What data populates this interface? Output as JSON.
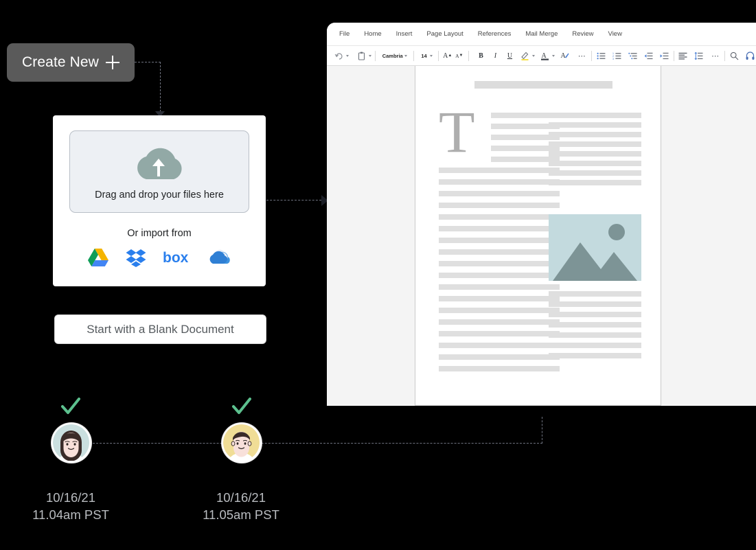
{
  "create_new": {
    "label": "Create New",
    "icon": "plus-icon"
  },
  "upload_card": {
    "dropzone": {
      "icon": "cloud-upload-icon",
      "label": "Drag and drop your files here"
    },
    "import_label": "Or import from",
    "services": [
      {
        "name": "google-drive",
        "label": "Google Drive"
      },
      {
        "name": "dropbox",
        "label": "Dropbox"
      },
      {
        "name": "box",
        "label": "Box"
      },
      {
        "name": "onedrive",
        "label": "OneDrive"
      }
    ]
  },
  "blank_doc_button": {
    "label": "Start with a Blank Document"
  },
  "editor": {
    "menu": [
      {
        "label": "File"
      },
      {
        "label": "Home"
      },
      {
        "label": "Insert"
      },
      {
        "label": "Page Layout"
      },
      {
        "label": "References"
      },
      {
        "label": "Mail Merge"
      },
      {
        "label": "Review"
      },
      {
        "label": "View"
      }
    ],
    "ribbon": {
      "undo_icon": "undo-icon",
      "paste_icon": "paste-icon",
      "font_name": "Cambria",
      "font_size": "14",
      "grow_font": "A",
      "shrink_font": "A",
      "bold": "B",
      "italic": "I",
      "underline": "U",
      "highlight_icon": "highlight-icon",
      "font_color": "A",
      "format_painter_icon": "format-painter-icon",
      "more_icon": "more-ellipsis-icon",
      "bullet_list_icon": "bullet-list-icon",
      "numbered_list_icon": "numbered-list-icon",
      "multilevel_list_icon": "multilevel-list-icon",
      "decrease_indent_icon": "decrease-indent-icon",
      "increase_indent_icon": "increase-indent-icon",
      "align_icon": "align-left-icon",
      "line_spacing_icon": "line-spacing-icon",
      "more_paragraph_icon": "more-ellipsis-icon",
      "search_icon": "search-icon",
      "dictate_icon": "dictate-icon"
    },
    "document": {
      "dropcap": "T",
      "image_placeholder": "mountain-image-placeholder"
    }
  },
  "timeline": {
    "nodes": [
      {
        "avatar": "avatar-woman",
        "status_icon": "check-icon",
        "date": "10/16/21",
        "time": "11.04am PST"
      },
      {
        "avatar": "avatar-man",
        "status_icon": "check-icon",
        "date": "10/16/21",
        "time": "11.05am PST"
      }
    ]
  },
  "colors": {
    "pill_bg": "#5a5a5a",
    "check_green": "#5cc08e",
    "dropzone_bg": "#edf0f4",
    "photo_bg": "#c3dade",
    "avatar1_bg": "#cadfdf",
    "avatar2_bg": "#f0dd96"
  }
}
